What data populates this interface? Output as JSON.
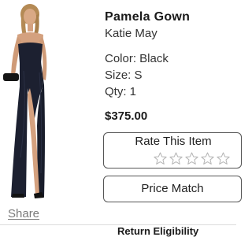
{
  "product": {
    "name": "Pamela Gown",
    "brand": "Katie May",
    "color_text": "Color: Black",
    "size_text": "Size: S",
    "qty_text": "Qty: 1",
    "price": "$375.00"
  },
  "rating": {
    "title": "Rate This Item",
    "max_stars": 5,
    "current_rating": 0
  },
  "actions": {
    "price_match_label": "Price Match",
    "share_label": "Share",
    "return_eligibility_label": "Return Eligibility"
  },
  "colors": {
    "dress": "#1c2030",
    "skin": "#d4a17f",
    "hair": "#b48a55"
  }
}
